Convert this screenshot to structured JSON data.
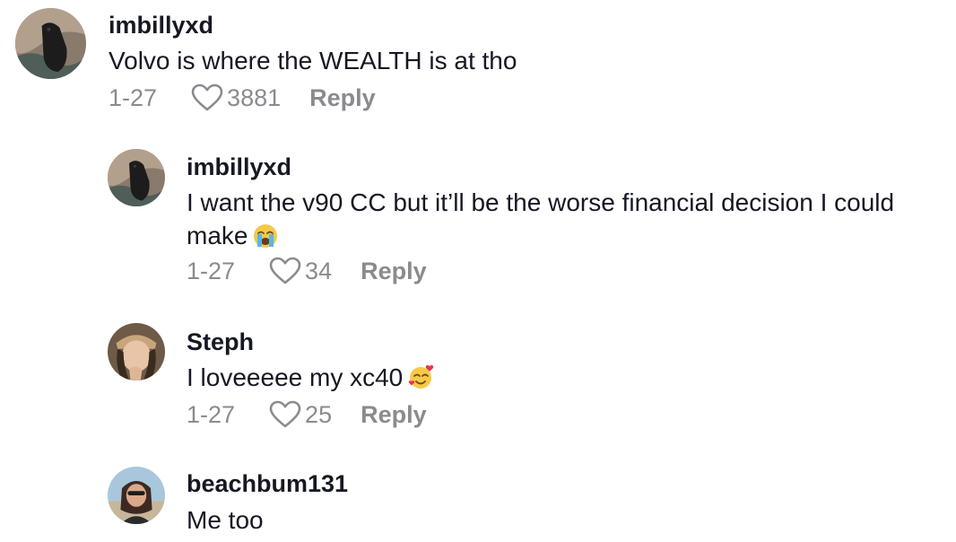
{
  "comments": [
    {
      "username": "imbillyxd",
      "text": "Volvo is where the WEALTH is at tho",
      "date": "1-27",
      "likes": "3881",
      "reply_label": "Reply"
    },
    {
      "username": "imbillyxd",
      "text": "I want the v90 CC but it’ll be the worse financial decision I could make",
      "emoji": "crying-face-icon",
      "date": "1-27",
      "likes": "34",
      "reply_label": "Reply"
    },
    {
      "username": "Steph",
      "text": "I loveeeee my xc40",
      "emoji": "smiling-face-with-hearts-icon",
      "date": "1-27",
      "likes": "25",
      "reply_label": "Reply"
    },
    {
      "username": "beachbum131",
      "text": "Me too"
    }
  ]
}
